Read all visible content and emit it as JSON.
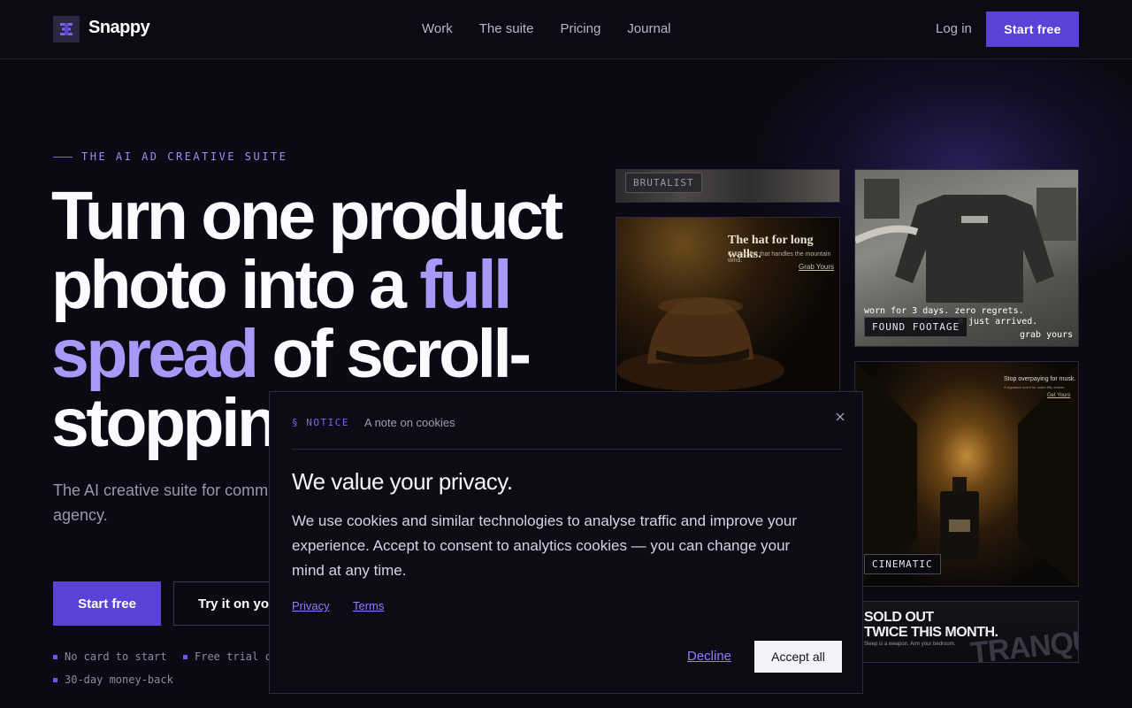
{
  "header": {
    "brand": "Snappy",
    "nav": [
      "Work",
      "The suite",
      "Pricing",
      "Journal"
    ],
    "login": "Log in",
    "cta": "Start free"
  },
  "hero": {
    "eyebrow": "THE AI AD CREATIVE SUITE",
    "headline": {
      "part1": "Turn one product photo into a ",
      "accent": "full spread",
      "part2": " of scroll-stopping"
    },
    "subcopy": "The AI creative suite for comm editorial cards — platform-size or agency.",
    "primary_cta": "Start free",
    "secondary_cta": "Try it on you",
    "perks": [
      "No card to start",
      "Free trial c",
      "30-day money-back"
    ]
  },
  "gallery": {
    "tags": [
      "BRUTALIST",
      "FOUND FOOTAGE",
      "CINEMATIC"
    ],
    "hat_ad": {
      "headline": "The hat for long walks.",
      "sub": "Classic felt that handles the mountain wind.",
      "cta": "Grab Yours"
    },
    "sweater_ad": {
      "line1": "worn for 3 days. zero regrets.",
      "line2": "m just arrived.",
      "cta": "grab yours"
    },
    "perfume_ad": {
      "headline": "Stop overpaying for musk.",
      "sub": "A signature scent for under fifty dollars.",
      "cta": "Get Yours"
    },
    "soldout_ad": {
      "line1": "SOLD OUT",
      "line2": "TWICE THIS MONTH.",
      "sub": "Sleep is a weapon. Arm your bedroom.",
      "bg_word": "TRANQUILITY"
    }
  },
  "cookie_modal": {
    "label": "§ NOTICE",
    "sublabel": "A note on cookies",
    "title": "We value your privacy.",
    "body": "We use cookies and similar technologies to analyse traffic and improve your experience. Accept to consent to analytics cookies — you can change your mind at any time.",
    "links": [
      "Privacy",
      "Terms"
    ],
    "decline": "Decline",
    "accept": "Accept all"
  },
  "colors": {
    "accent": "#5b42d6",
    "accent_light": "#a898f7",
    "background": "#0b0a14"
  }
}
